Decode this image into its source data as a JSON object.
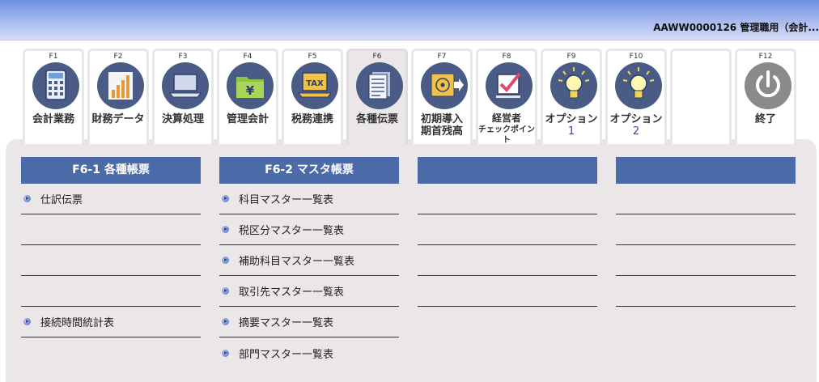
{
  "header": {
    "user_info": "AAWW0000126 管理職用（会計..."
  },
  "tabs": [
    {
      "key": "F1",
      "label": "会計業務",
      "icon": "calculator-icon"
    },
    {
      "key": "F2",
      "label": "財務データ",
      "icon": "bar-chart-icon"
    },
    {
      "key": "F3",
      "label": "決算処理",
      "icon": "laptop-icon"
    },
    {
      "key": "F4",
      "label": "管理会計",
      "icon": "yen-folder-icon"
    },
    {
      "key": "F5",
      "label": "税務連携",
      "icon": "tax-laptop-icon"
    },
    {
      "key": "F6",
      "label": "各種伝票",
      "icon": "documents-icon"
    },
    {
      "key": "F7",
      "label": "初期導入期首残高",
      "label_line1": "初期導入",
      "label_line2": "期首残高",
      "icon": "disk-export-icon"
    },
    {
      "key": "F8",
      "label": "経営者チェックポイント",
      "label_line1": "経営者",
      "label_line2": "チェックポイント",
      "icon": "checkbox-icon"
    },
    {
      "key": "F9",
      "label": "オプション",
      "sub": "1",
      "icon": "lightbulb-icon"
    },
    {
      "key": "F10",
      "label": "オプション",
      "sub": "2",
      "icon": "lightbulb-icon"
    },
    {
      "key": "F12",
      "label": "終了",
      "icon": "power-icon"
    }
  ],
  "columns": [
    {
      "title": "F6-1 各種帳票",
      "rows": [
        "仕訳伝票",
        "",
        "",
        "",
        "接続時間統計表",
        ""
      ]
    },
    {
      "title": "F6-2 マスタ帳票",
      "rows": [
        "科目マスター一覧表",
        "税区分マスター一覧表",
        "補助科目マスター一覧表",
        "取引先マスター一覧表",
        "摘要マスター一覧表",
        "部門マスター一覧表"
      ]
    },
    {
      "title": "",
      "rows": [
        "",
        "",
        "",
        ""
      ]
    },
    {
      "title": "",
      "rows": [
        "",
        "",
        "",
        ""
      ]
    }
  ],
  "colors": {
    "accent": "#4a6aa8",
    "icon_circle": "#4b5b87",
    "panel": "#ebe7e8"
  }
}
